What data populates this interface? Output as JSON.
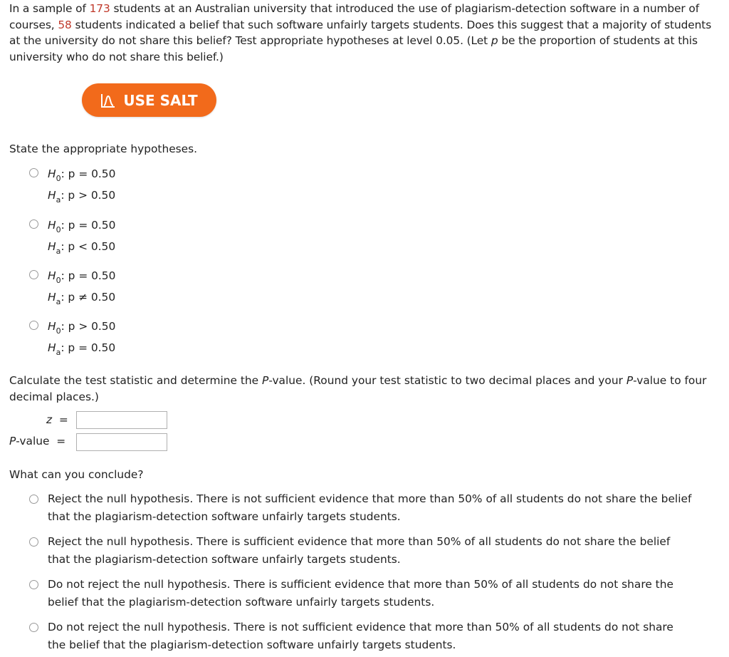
{
  "question": {
    "part1": "In a sample of ",
    "sample_size": "173",
    "part2": " students at an Australian university that introduced the use of plagiarism-detection software in a number of courses, ",
    "count": "58",
    "part3": " students indicated a belief that such software unfairly targets students. Does this suggest that a majority of students at the university do not share this belief? Test appropriate hypotheses at level 0.05. (Let ",
    "var": "p",
    "part4": " be the proportion of students at this university who do not share this belief.)"
  },
  "salt_button": {
    "label": "USE SALT",
    "color": "#f26a1b"
  },
  "hypotheses": {
    "prompt": "State the appropriate hypotheses.",
    "options": [
      {
        "h0": ": p = 0.50",
        "ha": ": p > 0.50"
      },
      {
        "h0": ": p = 0.50",
        "ha": ": p < 0.50"
      },
      {
        "h0": ": p = 0.50",
        "ha": ": p ≠ 0.50"
      },
      {
        "h0": ": p > 0.50",
        "ha": ": p = 0.50"
      }
    ],
    "h_symbol": "H",
    "h0_sub": "0",
    "ha_sub": "a"
  },
  "calc": {
    "prompt_a": "Calculate the test statistic and determine the ",
    "prompt_pv": "P",
    "prompt_b": "-value. (Round your test statistic to two decimal places and your ",
    "prompt_c": "-value to four decimal places.)",
    "z_label": "z",
    "pvalue_label_p": "P",
    "pvalue_label_rest": "-value",
    "equals": "=",
    "z_value": "",
    "p_value": ""
  },
  "conclusion": {
    "prompt": "What can you conclude?",
    "options": [
      {
        "line1": "Reject the null hypothesis. There is not sufficient evidence that more than 50% of all students do not share the belief",
        "line2": "that the plagiarism-detection software unfairly targets students."
      },
      {
        "line1": "Reject the null hypothesis. There is sufficient evidence that more than 50% of all students do not share the belief",
        "line2": "that the plagiarism-detection software unfairly targets students."
      },
      {
        "line1": "Do not reject the null hypothesis. There is sufficient evidence that more than 50% of all students do not share the",
        "line2": "belief that the plagiarism-detection software unfairly targets students."
      },
      {
        "line1": "Do not reject the null hypothesis. There is not sufficient evidence that more than 50% of all students do not share",
        "line2": "the belief that the plagiarism-detection software unfairly targets students."
      }
    ]
  }
}
